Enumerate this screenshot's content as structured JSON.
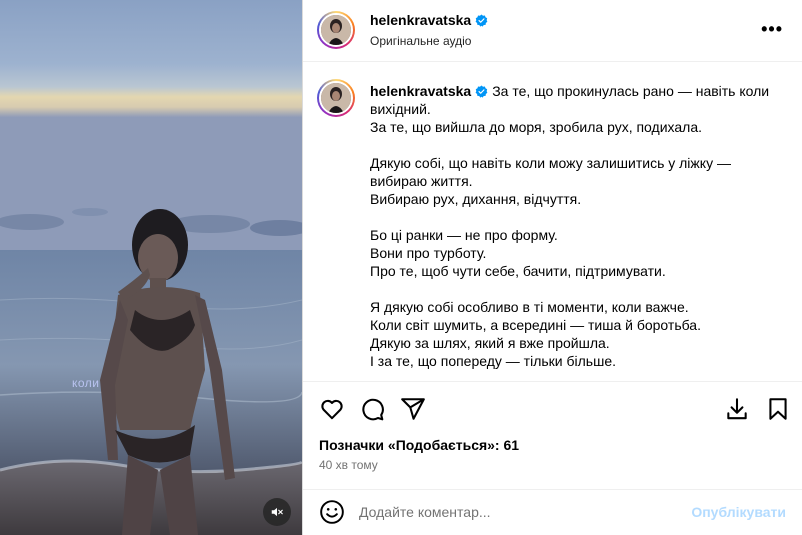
{
  "header": {
    "username": "helenkravatska",
    "subtitle": "Оригінальне аудіо",
    "more": "•••"
  },
  "media": {
    "overlay_text": "коли"
  },
  "caption": {
    "username": "helenkravatska",
    "lines": [
      "За те, що прокинулась рано — навіть коли",
      "вихідний.",
      "За те, що вийшла до моря, зробила рух, подихала.",
      "",
      "Дякую собі, що навіть коли можу залишитись у ліжку —",
      "вибираю життя.",
      "Вибираю рух, дихання, відчуття.",
      "",
      "Бо ці ранки — не про форму.",
      "Вони про турботу.",
      "Про те, щоб чути себе, бачити, підтримувати.",
      "",
      "Я дякую собі особливо в ті моменти, коли важче.",
      "Коли світ шумить, а всередині — тиша й боротьба.",
      "Дякую за шлях, який я вже пройшла.",
      "І за те, що попереду — тільки більше."
    ]
  },
  "stats": {
    "likes": "Позначки «Подобається»: 61",
    "time": "40 хв тому"
  },
  "comment": {
    "placeholder": "Додайте коментар...",
    "publish": "Опублікувати"
  },
  "colors": {
    "verified": "#0095f6",
    "publish_disabled": "#b3dbff",
    "muted_text": "#737373"
  }
}
